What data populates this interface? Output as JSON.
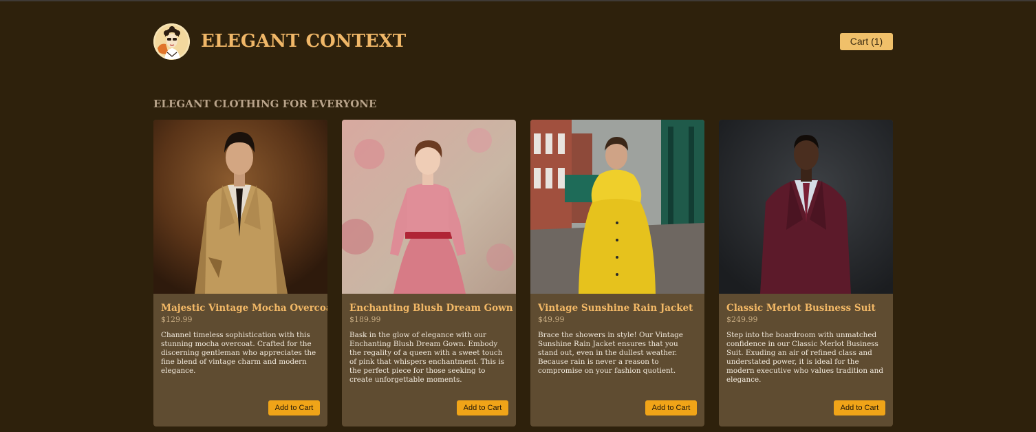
{
  "header": {
    "brand": "ELEGANT CONTEXT",
    "cart_label": "Cart (1)"
  },
  "section": {
    "title": "ELEGANT CLOTHING FOR EVERYONE"
  },
  "products": [
    {
      "name": "Majestic Vintage Mocha Overcoat",
      "price": "$129.99",
      "description": "Channel timeless sophistication with this stunning mocha overcoat. Crafted for the discerning gentleman who appreciates the fine blend of vintage charm and modern elegance.",
      "add_label": "Add to Cart"
    },
    {
      "name": "Enchanting Blush Dream Gown",
      "price": "$189.99",
      "description": "Bask in the glow of elegance with our Enchanting Blush Dream Gown. Embody the regality of a queen with a sweet touch of pink that whispers enchantment. This is the perfect piece for those seeking to create unforgettable moments.",
      "add_label": "Add to Cart"
    },
    {
      "name": "Vintage Sunshine Rain Jacket",
      "price": "$49.99",
      "description": "Brace the showers in style! Our Vintage Sunshine Rain Jacket ensures that you stand out, even in the dullest weather. Because rain is never a reason to compromise on your fashion quotient.",
      "add_label": "Add to Cart"
    },
    {
      "name": "Classic Merlot Business Suit",
      "price": "$249.99",
      "description": "Step into the boardroom with unmatched confidence in our Classic Merlot Business Suit. Exuding an air of refined class and understated power, it is ideal for the modern executive who values tradition and elegance.",
      "add_label": "Add to Cart"
    }
  ],
  "colors": {
    "background": "#2e210c",
    "card": "#5f4c31",
    "brand": "#f0b768",
    "accent_button": "#f0a418",
    "cart_button": "#f0c06a"
  },
  "icons": {
    "logo": "vintage-woman-portrait-logo"
  }
}
